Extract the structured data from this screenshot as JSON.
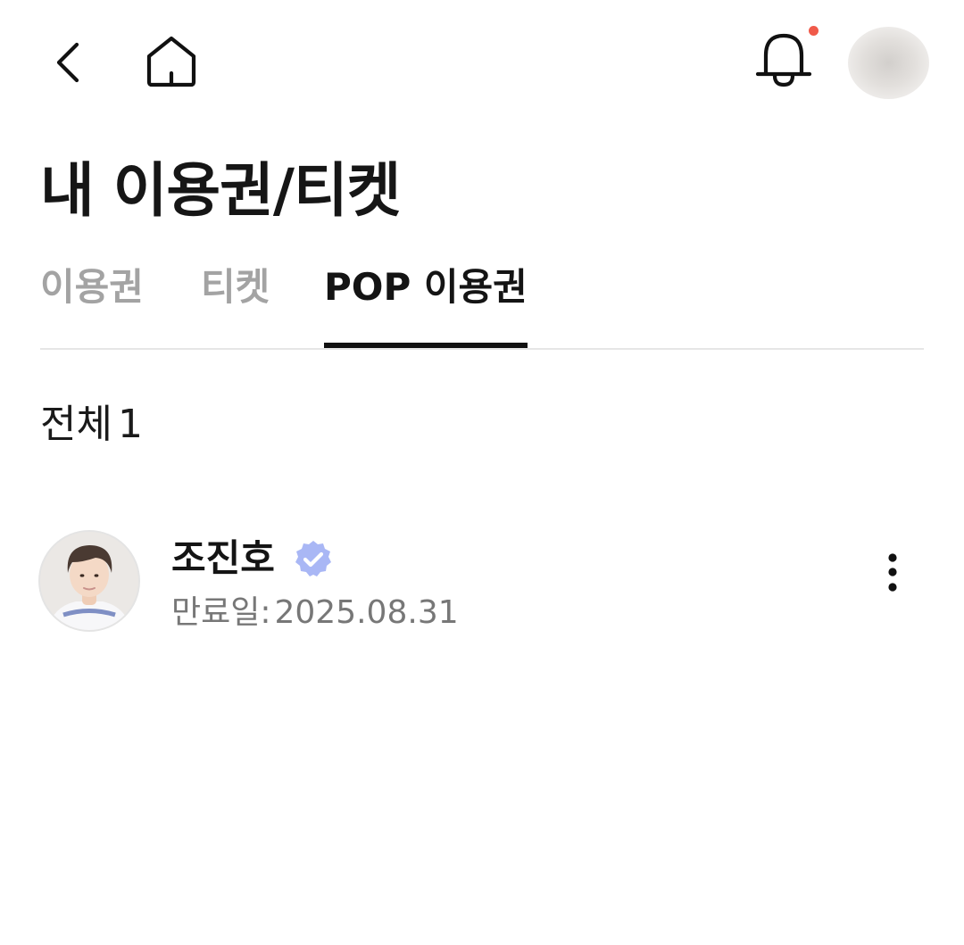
{
  "header": {
    "back_icon": "chevron-left-icon",
    "home_icon": "home-icon",
    "bell_icon": "bell-icon",
    "notification_dot_color": "#f05a4a",
    "profile_avatar": "blurred-avatar"
  },
  "page": {
    "title": "내 이용권/티켓"
  },
  "tabs": [
    {
      "label": "이용권",
      "active": false
    },
    {
      "label": "티켓",
      "active": false
    },
    {
      "label": "POP 이용권",
      "active": true
    }
  ],
  "summary": {
    "label": "전체",
    "count": "1"
  },
  "passes": [
    {
      "artist_name": "조진호",
      "verified": true,
      "verified_color": "#a9b7f5",
      "expire_label": "만료일:",
      "expire_date": "2025.08.31",
      "more_icon": "more-vertical-icon"
    }
  ]
}
